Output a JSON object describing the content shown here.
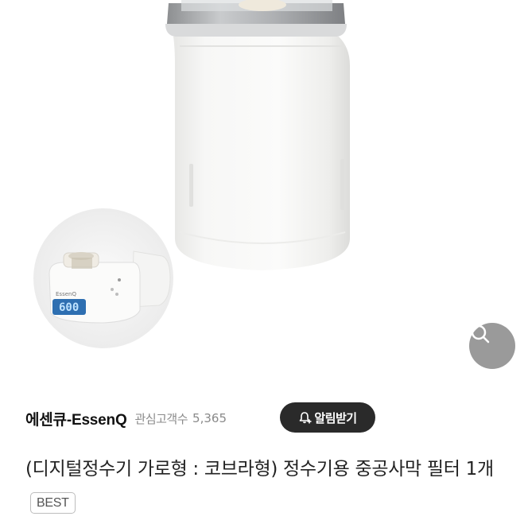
{
  "seller": {
    "name": "에센큐-EssenQ",
    "follow_label": "관심고객수",
    "follow_count": "5,365"
  },
  "alarm_button": {
    "label": "알림받기",
    "icon": "bell-plus-icon"
  },
  "zoom_button": {
    "icon": "search-icon"
  },
  "product": {
    "title": "(디지털정수기 가로형 : 코브라형) 정수기용 중공사막 필터 1개",
    "badge": "BEST"
  },
  "inset": {
    "brand": "EssenQ",
    "display": "600"
  }
}
